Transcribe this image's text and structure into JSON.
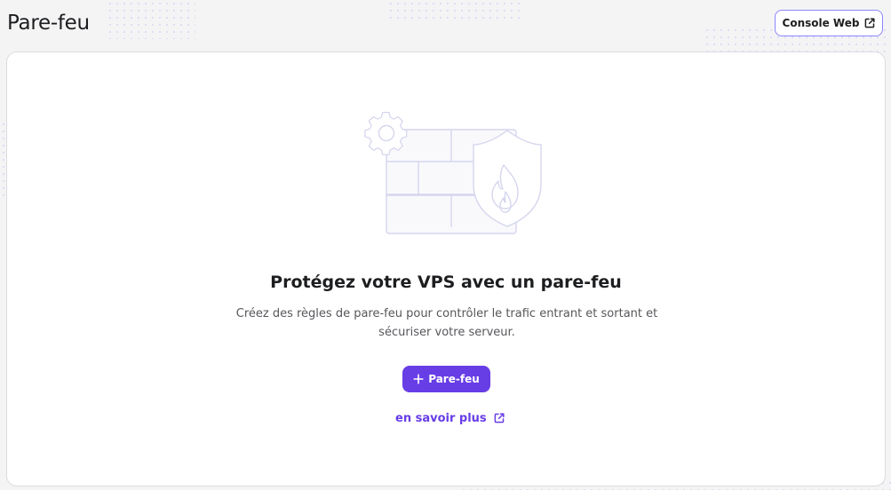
{
  "header": {
    "title": "Pare-feu",
    "console_button_label": "Console Web"
  },
  "empty_state": {
    "title": "Protégez votre VPS avec un pare-feu",
    "description": "Créez des règles de pare-feu pour contrôler le trafic entrant et sortant et sécuriser votre serveur.",
    "primary_button_label": "Pare-feu",
    "learn_more_label": "en savoir plus"
  },
  "icons": {
    "console_button": "external-link-icon",
    "primary_button": "plus-icon",
    "learn_more": "external-link-icon",
    "illustration": [
      "gear-icon",
      "brick-wall-icon",
      "shield-flame-icon"
    ]
  },
  "colors": {
    "accent": "#673de6",
    "accent_border": "#8c85ff",
    "illustration_stroke": "#d5d6ee",
    "page_background": "#f4f4f5",
    "card_background": "#ffffff"
  }
}
